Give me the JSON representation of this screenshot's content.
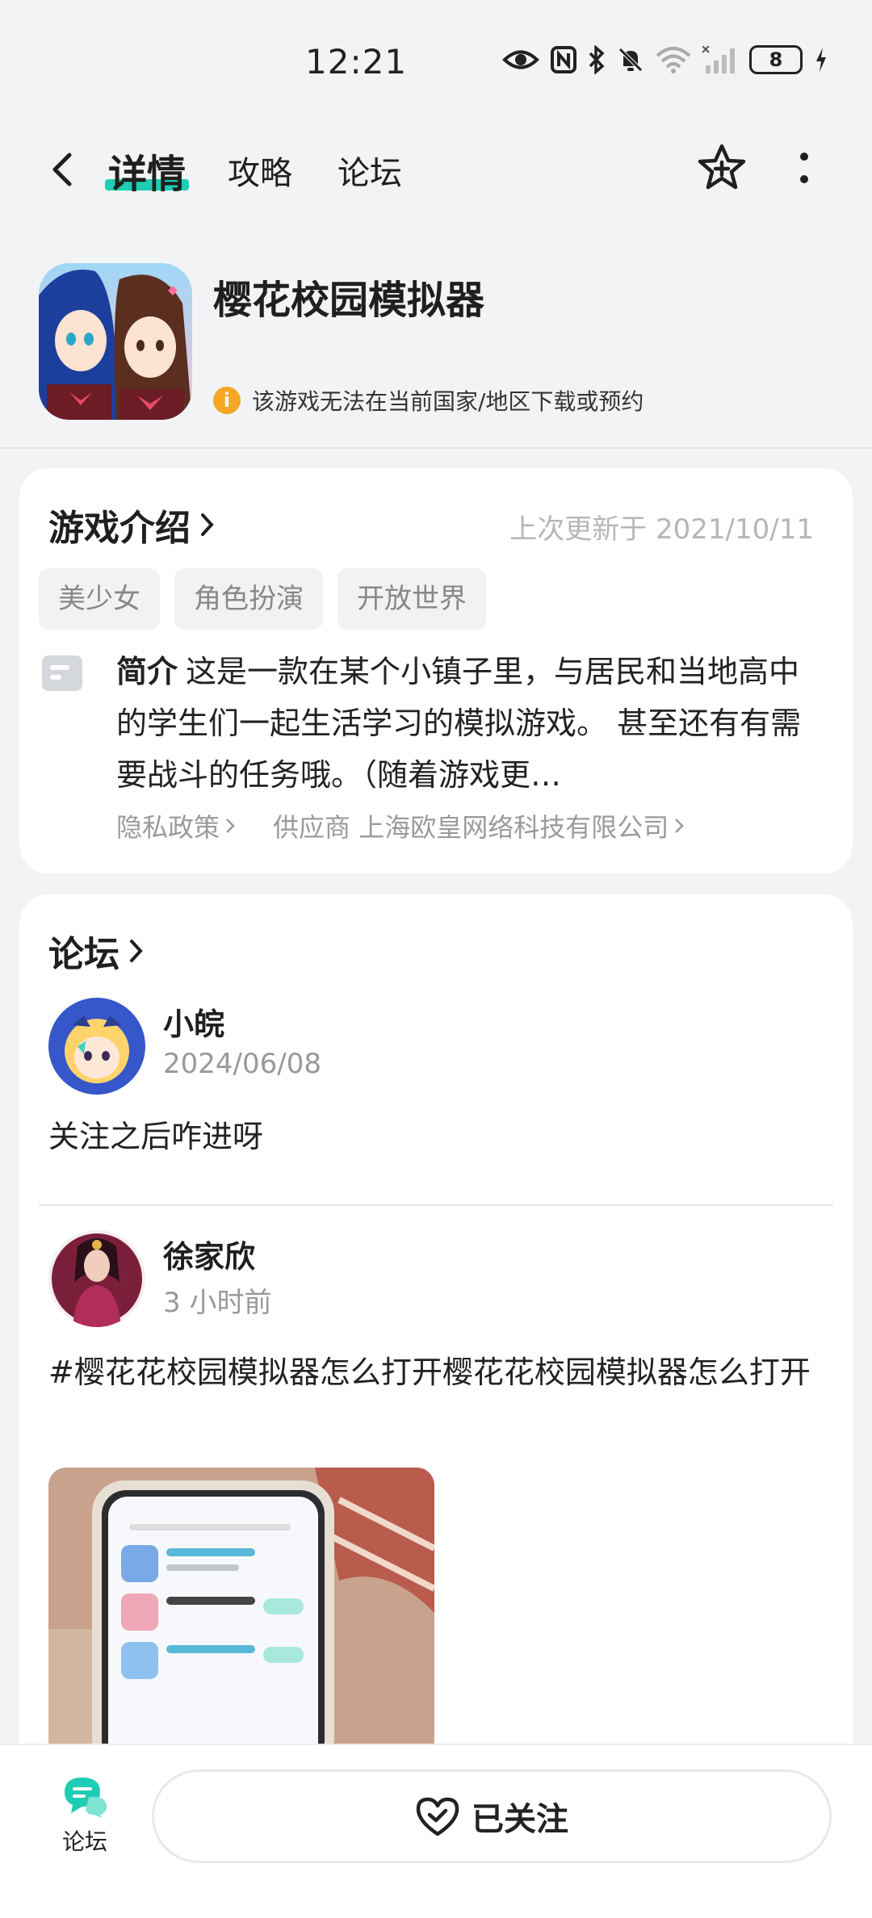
{
  "status_bar": {
    "time": "12:21",
    "battery": "8"
  },
  "nav": {
    "tabs": [
      {
        "label": "详情",
        "active": true
      },
      {
        "label": "攻略",
        "active": false
      },
      {
        "label": "论坛",
        "active": false
      }
    ]
  },
  "app": {
    "name": "樱花校园模拟器",
    "region_note": "该游戏无法在当前国家/地区下载或预约"
  },
  "intro": {
    "title": "游戏介绍",
    "updated": "上次更新于 2021/10/11",
    "tags": [
      "美少女",
      "角色扮演",
      "开放世界"
    ],
    "summary_label": "简介",
    "summary_text": "这是一款在某个小镇子里，与居民和当地高中的学生们一起生活学习的模拟游戏。 甚至还有有需要战斗的任务哦。（随着游戏更…",
    "privacy_label": "隐私政策",
    "supplier_label": "供应商 上海欧皇网络科技有限公司"
  },
  "forum": {
    "title": "论坛",
    "posts": [
      {
        "author": "小皖",
        "time": "2024/06/08",
        "text": "关注之后咋进呀"
      },
      {
        "author": "徐家欣",
        "time": "3 小时前",
        "text": "#樱花花校园模拟器怎么打开樱花花校园模拟器怎么打开"
      }
    ]
  },
  "bottom": {
    "forum_label": "论坛",
    "follow_label": "已关注"
  },
  "colors": {
    "accent": "#1ecdb3",
    "warning": "#f5a623",
    "background": "#f2f3f5"
  }
}
